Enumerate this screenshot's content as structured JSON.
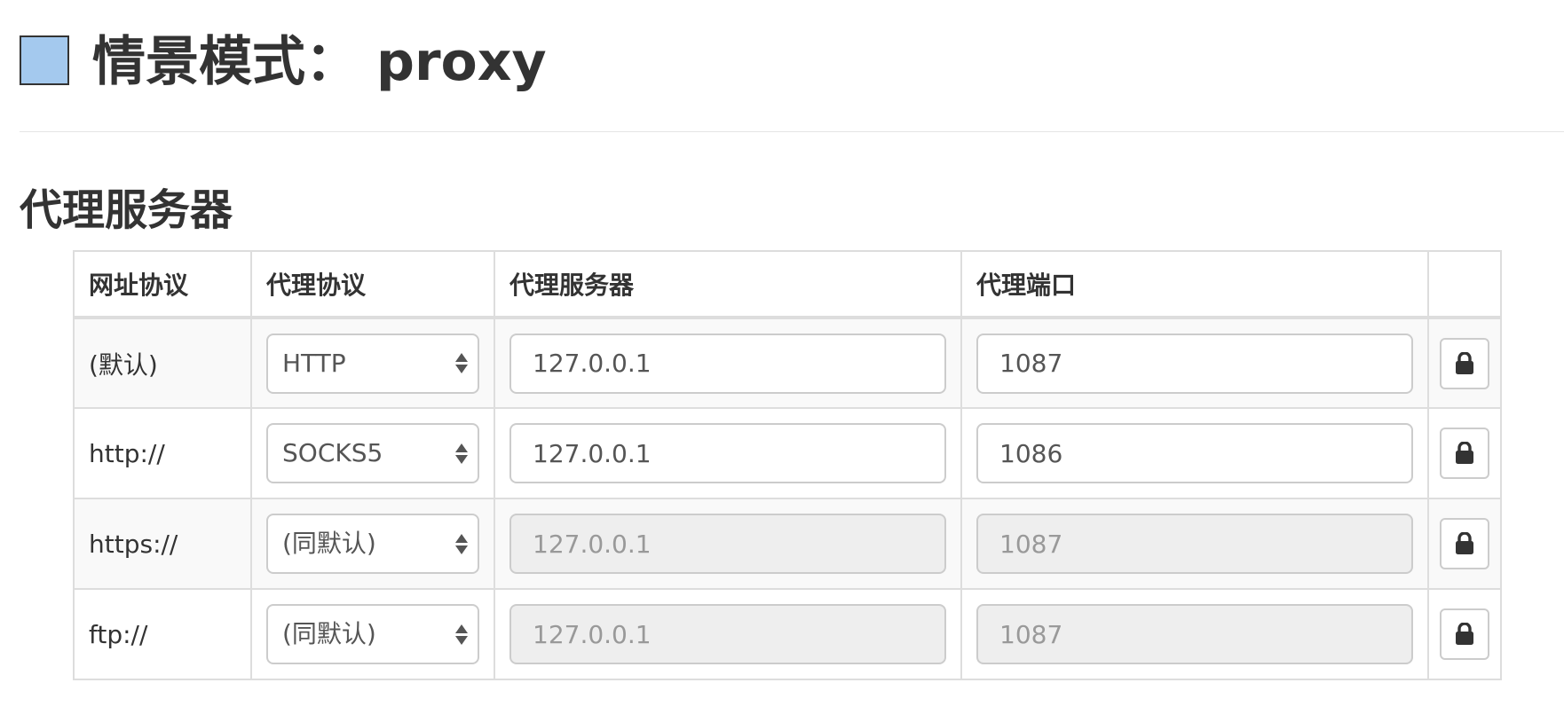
{
  "header": {
    "title_label": "情景模式：",
    "profile_name": "proxy",
    "swatch_color": "#a4c9ee"
  },
  "proxy_section": {
    "title": "代理服务器",
    "columns": [
      "网址协议",
      "代理协议",
      "代理服务器",
      "代理端口",
      ""
    ],
    "rows": [
      {
        "scheme": "(默认)",
        "protocol": "HTTP",
        "server": "127.0.0.1",
        "port": "1087",
        "inputs_disabled": false,
        "action_icon": "lock-icon"
      },
      {
        "scheme": "http://",
        "protocol": "SOCKS5",
        "server": "127.0.0.1",
        "port": "1086",
        "inputs_disabled": false,
        "action_icon": "lock-icon"
      },
      {
        "scheme": "https://",
        "protocol": "(同默认)",
        "server": "127.0.0.1",
        "port": "1087",
        "inputs_disabled": true,
        "action_icon": "lock-icon"
      },
      {
        "scheme": "ftp://",
        "protocol": "(同默认)",
        "server": "127.0.0.1",
        "port": "1087",
        "inputs_disabled": true,
        "action_icon": "lock-icon"
      }
    ]
  },
  "colors": {
    "text": "#333333",
    "border": "#dddddd",
    "stripe": "#f9f9f9",
    "disabled_input": "#eeeeee"
  }
}
